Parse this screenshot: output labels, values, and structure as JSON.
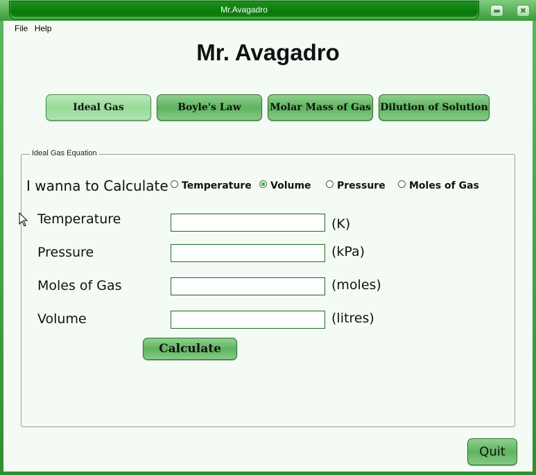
{
  "window": {
    "title": "Mr.Avagadro",
    "minimize_icon": "minimize-icon",
    "close_icon": "close-icon"
  },
  "menu": {
    "items": [
      {
        "label": "File"
      },
      {
        "label": "Help"
      }
    ]
  },
  "app_title": "Mr. Avagadro",
  "nav_buttons": [
    {
      "label": "Ideal Gas",
      "active": true
    },
    {
      "label": "Boyle's Law"
    },
    {
      "label": "Molar Mass of Gas"
    },
    {
      "label": "Dilution of Solution"
    }
  ],
  "panel": {
    "legend": "Ideal Gas Equation",
    "calculate_prompt": "I wanna to Calculate",
    "options": [
      {
        "label": "Temperature",
        "selected": false
      },
      {
        "label": "Volume",
        "selected": true
      },
      {
        "label": "Pressure",
        "selected": false
      },
      {
        "label": "Moles of Gas",
        "selected": false
      }
    ],
    "fields": [
      {
        "label": "Temperature",
        "value": "",
        "unit": "(K)"
      },
      {
        "label": "Pressure",
        "value": "",
        "unit": "(kPa)"
      },
      {
        "label": "Moles of Gas",
        "value": "",
        "unit": "(moles)"
      },
      {
        "label": "Volume",
        "value": "",
        "unit": "(litres)"
      }
    ],
    "calculate_label": "Calculate"
  },
  "quit_label": "Quit",
  "colors": {
    "accent": "#0a7a0a",
    "button": "#7ccb7c",
    "background": "#f4fbf4"
  }
}
